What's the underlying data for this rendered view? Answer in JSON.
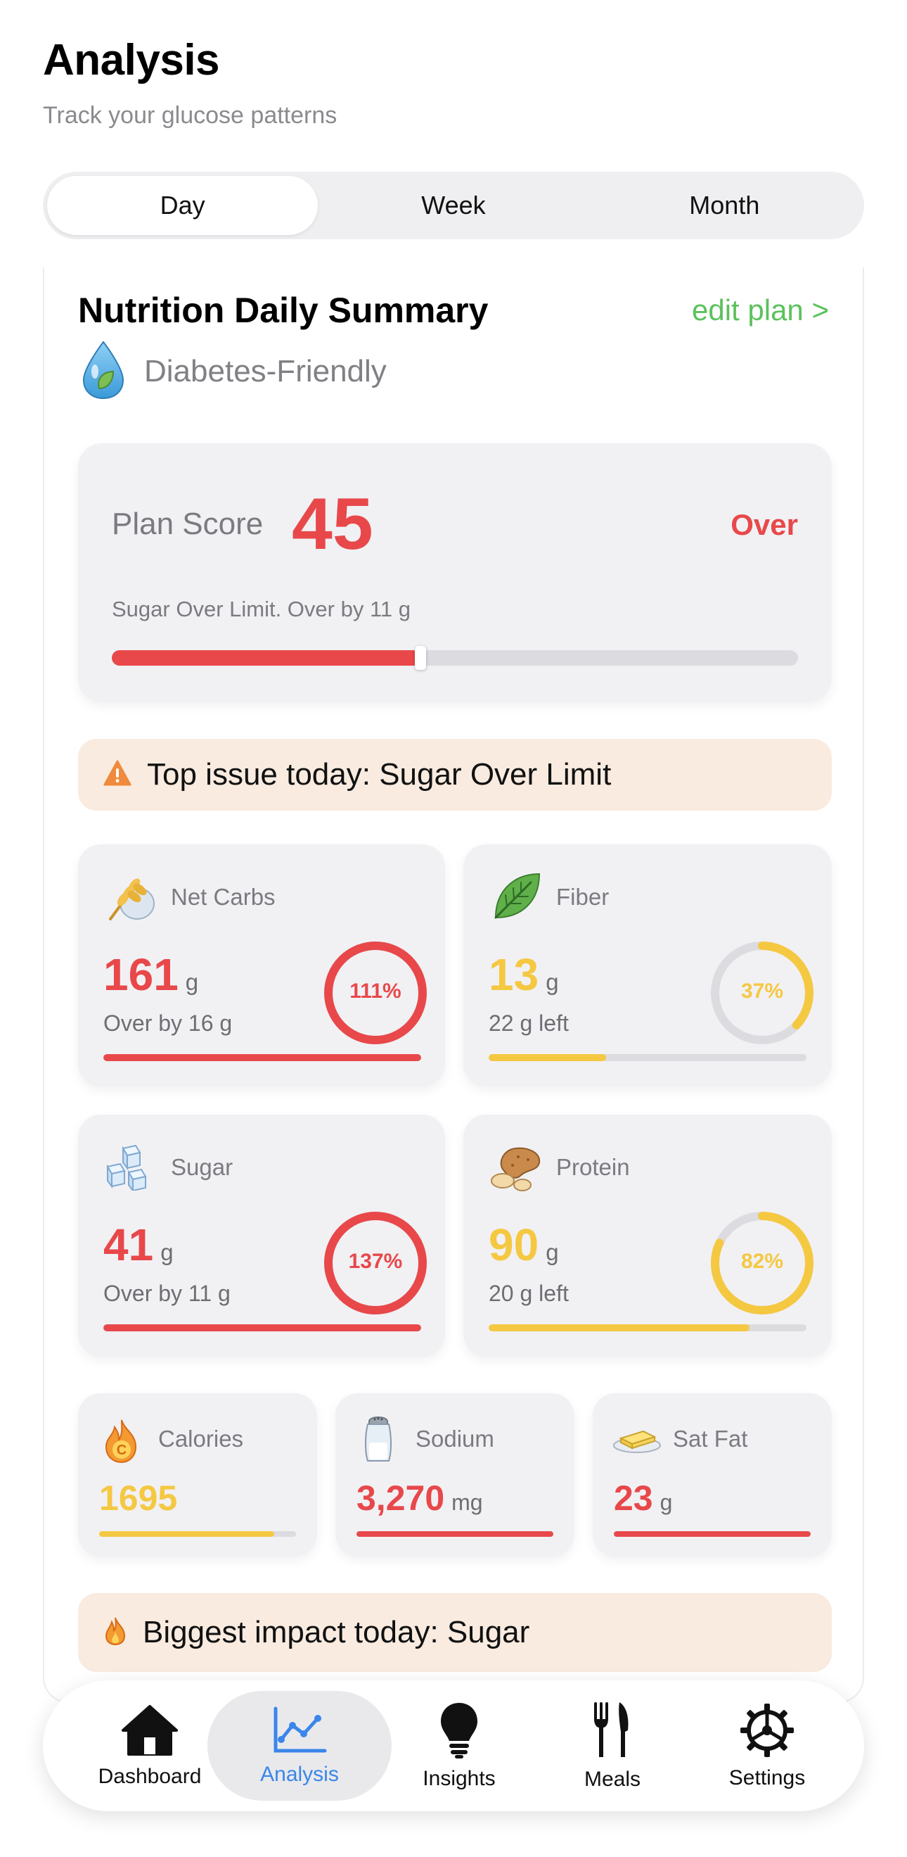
{
  "header": {
    "title": "Analysis",
    "subtitle": "Track your glucose patterns"
  },
  "tabs": [
    {
      "label": "Day",
      "active": true
    },
    {
      "label": "Week",
      "active": false
    },
    {
      "label": "Month",
      "active": false
    }
  ],
  "summary": {
    "title": "Nutrition Daily Summary",
    "edit_label": "edit plan >",
    "plan_type": "Diabetes-Friendly",
    "plan_icon": "water-drop-leaf-icon"
  },
  "score": {
    "label": "Plan Score",
    "value": "45",
    "status": "Over",
    "note": "Sugar Over Limit. Over by 11 g",
    "progress": 0.45
  },
  "top_issue": {
    "icon": "warning-icon",
    "text": "Top issue today: Sugar Over Limit"
  },
  "nutrients": {
    "net_carbs": {
      "label": "Net Carbs",
      "icon": "wheat-icon",
      "value": "161",
      "unit": "g",
      "sub": "Over by 16 g",
      "percent_label": "111%",
      "progress": 1.0,
      "color": "#e8484a"
    },
    "fiber": {
      "label": "Fiber",
      "icon": "leaf-icon",
      "value": "13",
      "unit": "g",
      "sub": "22 g left",
      "percent_label": "37%",
      "progress": 0.37,
      "color": "#f5c842"
    },
    "sugar": {
      "label": "Sugar",
      "icon": "sugar-cubes-icon",
      "value": "41",
      "unit": "g",
      "sub": "Over by 11 g",
      "percent_label": "137%",
      "progress": 1.0,
      "color": "#e8484a"
    },
    "protein": {
      "label": "Protein",
      "icon": "protein-icon",
      "value": "90",
      "unit": "g",
      "sub": "20 g left",
      "percent_label": "82%",
      "progress": 0.82,
      "color": "#f5c842"
    }
  },
  "small_stats": {
    "calories": {
      "label": "Calories",
      "icon": "flame-icon",
      "value": "1695",
      "unit": "",
      "progress": 0.89,
      "color": "#f5c842"
    },
    "sodium": {
      "label": "Sodium",
      "icon": "salt-shaker-icon",
      "value": "3,270",
      "unit": "mg",
      "progress": 1.0,
      "color": "#e8484a"
    },
    "sat_fat": {
      "label": "Sat Fat",
      "icon": "butter-icon",
      "value": "23",
      "unit": "g",
      "progress": 1.0,
      "color": "#e8484a"
    }
  },
  "biggest_impact": {
    "icon": "flame-icon",
    "text": "Biggest impact today: Sugar"
  },
  "nav": [
    {
      "label": "Dashboard",
      "icon": "home-icon",
      "active": false
    },
    {
      "label": "Analysis",
      "icon": "chart-line-icon",
      "active": true
    },
    {
      "label": "Insights",
      "icon": "lightbulb-icon",
      "active": false
    },
    {
      "label": "Meals",
      "icon": "fork-knife-icon",
      "active": false
    },
    {
      "label": "Settings",
      "icon": "gear-icon",
      "active": false
    }
  ],
  "colors": {
    "over": "#e8484a",
    "under": "#f5c842",
    "accent": "#3a86ea",
    "edit": "#5cc15c"
  }
}
